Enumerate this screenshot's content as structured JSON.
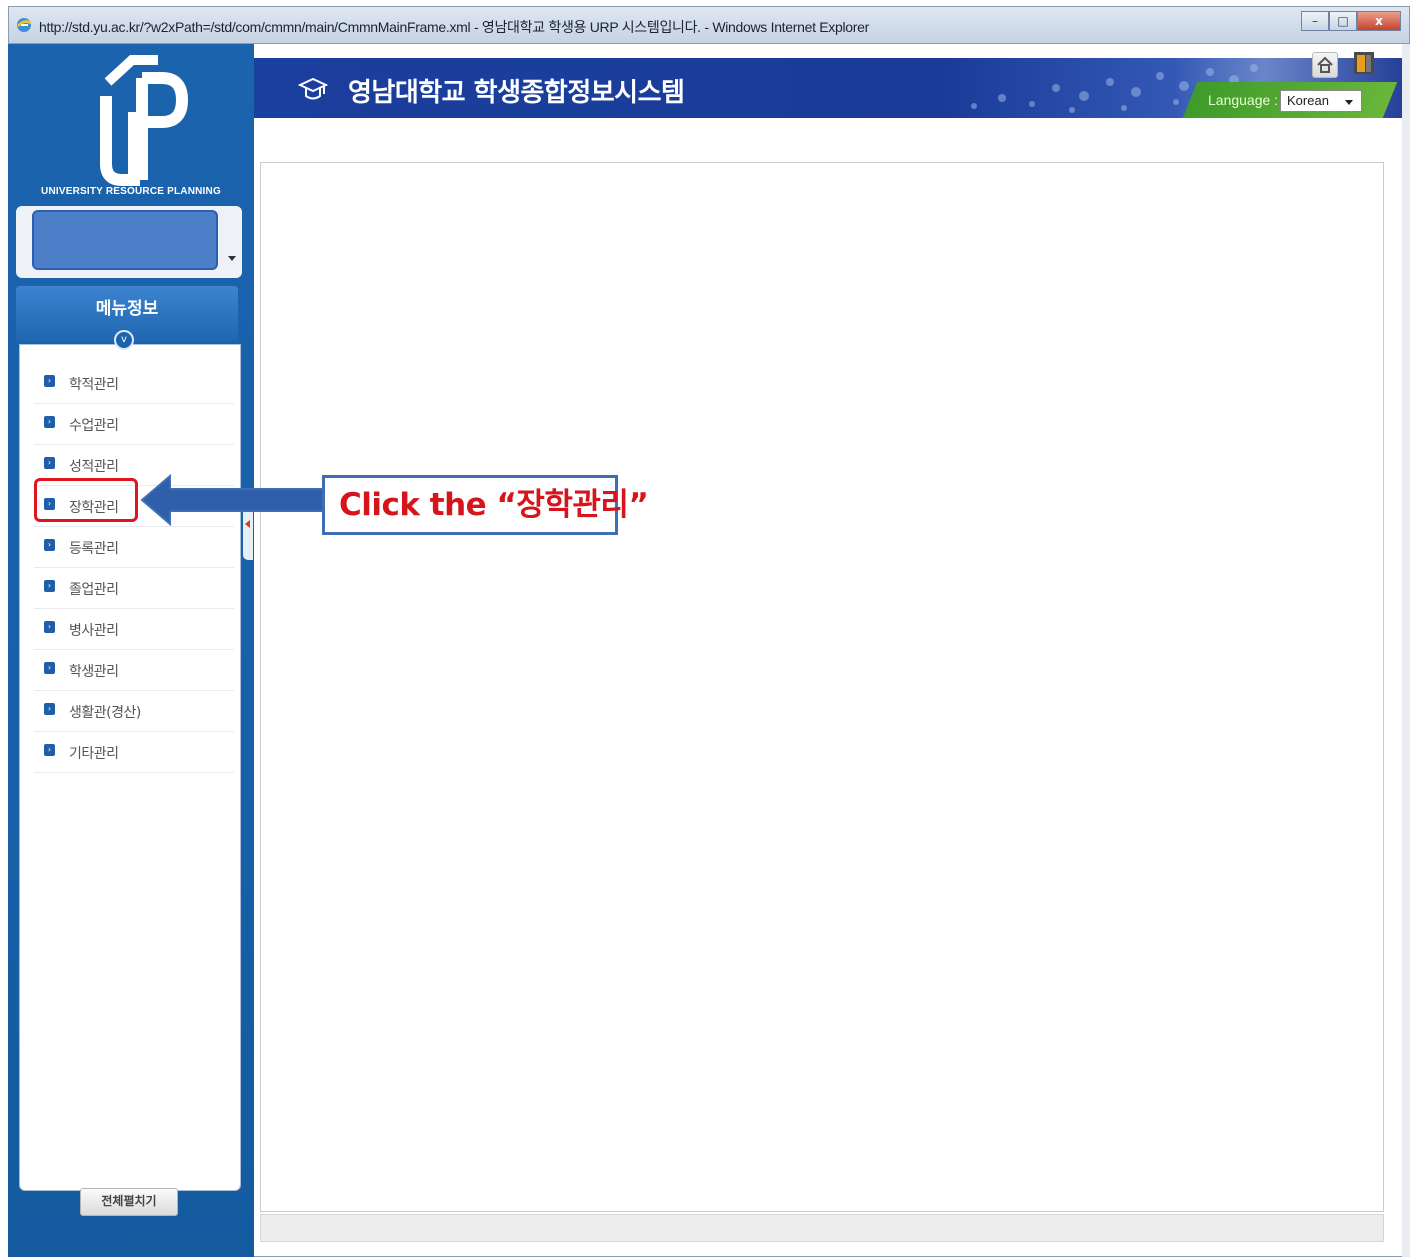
{
  "window": {
    "title": "http://std.yu.ac.kr/?w2xPath=/std/com/cmmn/main/CmmnMainFrame.xml - 영남대학교 학생용 URP 시스템입니다. - Windows Internet Explorer",
    "minimize": "–",
    "maximize": "□",
    "close": "x"
  },
  "sidebar": {
    "logo_caption": "UNIVERSITY RESOURCE PLANNING",
    "menu_header": "메뉴정보",
    "items": [
      {
        "label": "학적관리"
      },
      {
        "label": "수업관리"
      },
      {
        "label": "성적관리"
      },
      {
        "label": "장학관리"
      },
      {
        "label": "등록관리"
      },
      {
        "label": "졸업관리"
      },
      {
        "label": "병사관리"
      },
      {
        "label": "학생관리"
      },
      {
        "label": "생활관(경산)"
      },
      {
        "label": "기타관리"
      }
    ],
    "expand_all": "전체펼치기"
  },
  "header": {
    "title": "영남대학교 학생종합정보시스템",
    "language_label": "Language :",
    "language_value": "Korean"
  },
  "annotation": {
    "text": "Click the “장학관리”",
    "color": "#d7141c",
    "border_color": "#3e6fb5"
  },
  "colors": {
    "sidebar": "#1761a8",
    "banner": "#1b3f9e",
    "language_strip": "#4ea52f"
  }
}
